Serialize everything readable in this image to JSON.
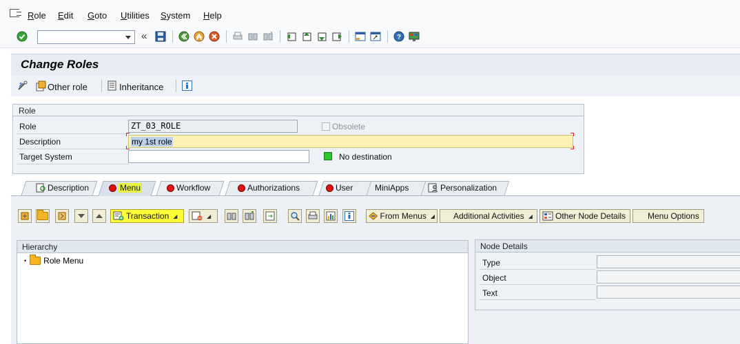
{
  "menubar": {
    "items": [
      "Role",
      "Edit",
      "Goto",
      "Utilities",
      "System",
      "Help"
    ]
  },
  "toolbar": {
    "command_value": "",
    "icons": [
      "enter-icon",
      "save-icon",
      "back-icon",
      "exit-icon",
      "cancel-icon",
      "print-icon",
      "find-icon",
      "find-next-icon",
      "first-page-icon",
      "previous-page-icon",
      "next-page-icon",
      "last-page-icon",
      "create-session-icon",
      "shortcut-icon",
      "help-icon",
      "customize-layout-icon"
    ]
  },
  "title": "Change Roles",
  "app_toolbar": {
    "other_role": "Other role",
    "inheritance": "Inheritance"
  },
  "role_group": {
    "title": "Role",
    "role_label": "Role",
    "role_value": "ZT_03_ROLE",
    "obsolete_label": "Obsolete",
    "description_label": "Description",
    "description_value": "my 1st role",
    "target_label": "Target System",
    "target_value": "",
    "destination_status": "No destination"
  },
  "tabs": [
    "Description",
    "Menu",
    "Workflow",
    "Authorizations",
    "User",
    "MiniApps",
    "Personalization"
  ],
  "menu_toolbar": {
    "transaction": "Transaction",
    "from_menus": "From Menus",
    "additional_activities": "Additional Activities",
    "other_node_details": "Other Node Details",
    "menu_options": "Menu Options"
  },
  "hierarchy": {
    "title": "Hierarchy",
    "root": "Role Menu"
  },
  "node_details": {
    "title": "Node Details",
    "type_label": "Type",
    "object_label": "Object",
    "text_label": "Text",
    "type_value": "",
    "object_value": "",
    "text_value": ""
  },
  "colors": {
    "accent_highlight": "#ffff38",
    "status_green": "#2cc52c",
    "status_red": "#e01010"
  }
}
